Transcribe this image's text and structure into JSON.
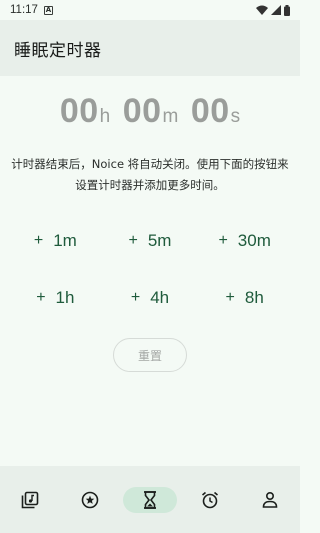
{
  "status_bar": {
    "time": "11:17",
    "notification_glyph": "A"
  },
  "app_bar": {
    "title": "睡眠定时器"
  },
  "timer": {
    "hours": "00",
    "hours_unit": "h",
    "minutes": "00",
    "minutes_unit": "m",
    "seconds": "00",
    "seconds_unit": "s"
  },
  "description": "计时器结束后，Noice 将自动关闭。使用下面的按钮来设置计时器并添加更多时间。",
  "add_buttons": [
    {
      "plus": "+",
      "label": "1m"
    },
    {
      "plus": "+",
      "label": "5m"
    },
    {
      "plus": "+",
      "label": "30m"
    },
    {
      "plus": "+",
      "label": "1h"
    },
    {
      "plus": "+",
      "label": "4h"
    },
    {
      "plus": "+",
      "label": "8h"
    }
  ],
  "reset_label": "重置",
  "bottom_nav": [
    {
      "icon": "music-library-icon",
      "active": false
    },
    {
      "icon": "star-circle-icon",
      "active": false
    },
    {
      "icon": "hourglass-icon",
      "active": true
    },
    {
      "icon": "alarm-clock-icon",
      "active": false
    },
    {
      "icon": "account-icon",
      "active": false
    }
  ],
  "colors": {
    "background": "#f4faf5",
    "bar": "#e8efea",
    "accent": "#1f5b3c",
    "active_pill": "#cfe8d9",
    "timer_text": "#9a9d9a"
  }
}
